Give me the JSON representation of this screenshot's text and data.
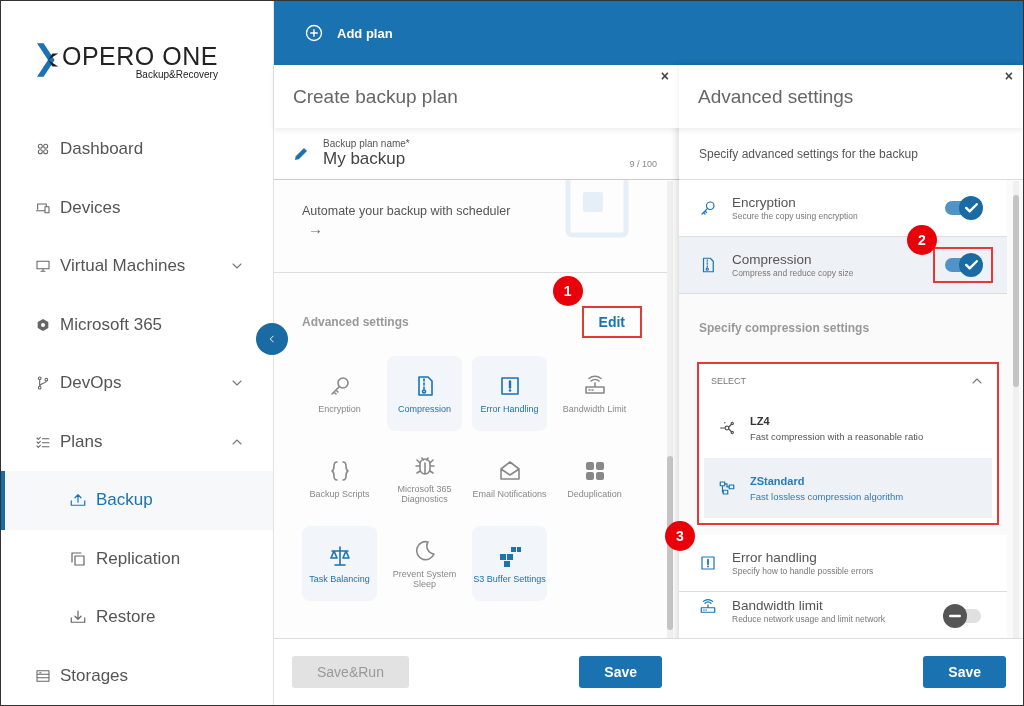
{
  "sidebar": {
    "logo": {
      "name": "OPERO ONE",
      "tagline": "Backup&Recovery"
    },
    "items": [
      {
        "label": "Dashboard"
      },
      {
        "label": "Devices"
      },
      {
        "label": "Virtual Machines",
        "expanded": false
      },
      {
        "label": "Microsoft 365"
      },
      {
        "label": "DevOps",
        "expanded": false
      },
      {
        "label": "Plans",
        "expanded": true,
        "children": [
          {
            "label": "Backup",
            "selected": true
          },
          {
            "label": "Replication",
            "selected": false
          },
          {
            "label": "Restore",
            "selected": false
          }
        ]
      },
      {
        "label": "Storages"
      }
    ]
  },
  "top_bar": {
    "action": "Add plan"
  },
  "plan_panel": {
    "title": "Create backup plan",
    "close": "×",
    "name_field": {
      "label": "Backup plan name*",
      "value": "My backup",
      "counter": "9 / 100"
    },
    "scheduler": {
      "text": "Automate your backup with scheduler",
      "arrow": "→"
    },
    "advanced": {
      "label": "Advanced settings",
      "edit": {
        "label": "Edit",
        "highlighted": true,
        "marker": "1"
      }
    },
    "features": [
      {
        "label": "Encryption",
        "enabled": false
      },
      {
        "label": "Compression",
        "enabled": true
      },
      {
        "label": "Error Handling",
        "enabled": true
      },
      {
        "label": "Bandwidth Limit",
        "enabled": false
      },
      {
        "label": "Backup Scripts",
        "enabled": false
      },
      {
        "label": "Microsoft 365 Diagnostics",
        "enabled": false
      },
      {
        "label": "Email Notifications",
        "enabled": false
      },
      {
        "label": "Deduplication",
        "enabled": false
      },
      {
        "label": "Task Balancing",
        "enabled": true
      },
      {
        "label": "Prevent System Sleep",
        "enabled": false
      },
      {
        "label": "S3 Buffer Settings",
        "enabled": true
      }
    ],
    "buttons": [
      {
        "label": "Save&Run",
        "disabled": true
      },
      {
        "label": "Save",
        "disabled": false
      }
    ]
  },
  "settings_panel": {
    "title": "Advanced settings",
    "close": "×",
    "subtitle": "Specify advanced settings for the backup",
    "rows": [
      {
        "kind": "toggle",
        "title": "Encryption",
        "description": "Secure the copy using encryption",
        "on": true,
        "selected": false,
        "highlighted": false
      },
      {
        "kind": "toggle",
        "title": "Compression",
        "description": "Compress and reduce copy size",
        "on": true,
        "selected": true,
        "highlighted": true,
        "marker": "2"
      },
      {
        "kind": "heading",
        "title": "Specify compression settings"
      },
      {
        "kind": "select",
        "label": "SELECT",
        "expanded": true,
        "highlighted": true,
        "marker": "3",
        "options": [
          {
            "label": "LZ4",
            "description": "Fast compression with a reasonable ratio",
            "selected": false
          },
          {
            "label": "ZStandard",
            "description": "Fast lossless compression algorithm",
            "selected": true
          }
        ]
      },
      {
        "kind": "info",
        "title": "Error handling",
        "description": "Specify how to handle possible errors"
      },
      {
        "kind": "toggle",
        "title": "Bandwidth limit",
        "description": "Reduce network usage and limit network",
        "on": false,
        "selected": false,
        "highlighted": false
      }
    ],
    "buttons": [
      {
        "label": "Save",
        "disabled": false
      }
    ]
  }
}
